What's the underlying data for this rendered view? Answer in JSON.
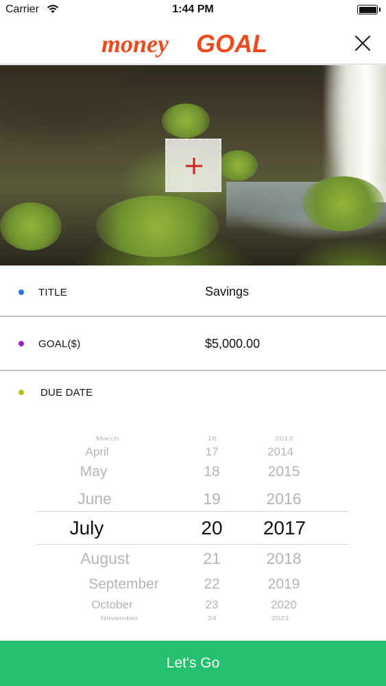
{
  "status_bar": {
    "carrier": "Carrier",
    "time": "1:44 PM",
    "wifi_icon": "wifi-icon",
    "battery_icon": "battery-icon"
  },
  "header": {
    "logo_text_1": "money",
    "logo_text_2": "GOAL",
    "logo_color": "#f04a1c",
    "close_icon": "close-icon"
  },
  "cover": {
    "add_photo_icon": "plus-icon",
    "add_photo_color": "#d0201a"
  },
  "form": {
    "title_label": "TITLE",
    "title_value": "Savings",
    "title_dot_color": "#2f6fe0",
    "goal_label": "GOAL($)",
    "goal_value": "$5,000.00",
    "goal_dot_color": "#a020c8",
    "due_label": "DUE DATE",
    "due_dot_color": "#b5c020"
  },
  "picker": {
    "months": [
      "March",
      "April",
      "May",
      "June",
      "July",
      "August",
      "September",
      "October",
      "November"
    ],
    "days": [
      "16",
      "17",
      "18",
      "19",
      "20",
      "21",
      "22",
      "23",
      "24"
    ],
    "years": [
      "2013",
      "2014",
      "2015",
      "2016",
      "2017",
      "2018",
      "2019",
      "2020",
      "2021"
    ],
    "selected_month": "July",
    "selected_day": "20",
    "selected_year": "2017"
  },
  "cta": {
    "label": "Let's Go",
    "color": "#25c06d"
  }
}
